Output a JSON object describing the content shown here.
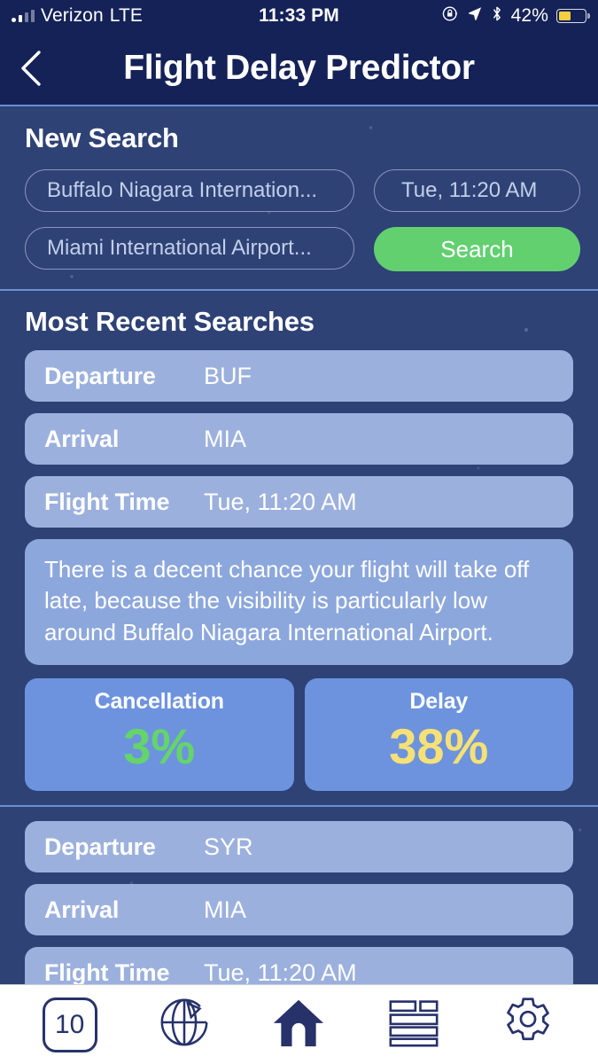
{
  "status_bar": {
    "carrier": "Verizon",
    "network": "LTE",
    "time": "11:33 PM",
    "battery_percent": "42%",
    "icons": [
      "signal-bars-icon",
      "rotation-lock-icon",
      "location-arrow-icon",
      "bluetooth-icon",
      "battery-icon"
    ],
    "battery_color": "#f3cf3f"
  },
  "navbar": {
    "back_icon": "chevron-left-icon",
    "title": "Flight Delay Predictor"
  },
  "new_search": {
    "title": "New Search",
    "departure_placeholder": "Buffalo Niagara Internation...",
    "departure_value": "",
    "arrival_placeholder": "Miami International Airport...",
    "arrival_value": "",
    "datetime_value": "Tue, 11:20 AM",
    "search_label": "Search",
    "search_color": "#63d070"
  },
  "recent": {
    "title": "Most Recent Searches",
    "entries": [
      {
        "rows": [
          {
            "label": "Departure",
            "value": "BUF"
          },
          {
            "label": "Arrival",
            "value": "MIA"
          },
          {
            "label": "Flight Time",
            "value": "Tue, 11:20 AM"
          }
        ],
        "note": "There is a decent chance your flight will take off late, because the visibility is particularly low around Buffalo Niagara International Airport.",
        "stats": [
          {
            "title": "Cancellation",
            "value": "3%",
            "color": "#64d46b"
          },
          {
            "title": "Delay",
            "value": "38%",
            "color": "#f5e175"
          }
        ]
      },
      {
        "rows": [
          {
            "label": "Departure",
            "value": "SYR"
          },
          {
            "label": "Arrival",
            "value": "MIA"
          },
          {
            "label": "Flight Time",
            "value": "Tue, 11:20 AM"
          }
        ]
      }
    ]
  },
  "toolbar": {
    "tab_count": "10",
    "items": [
      "tab-count-icon",
      "globe-icon",
      "home-icon",
      "layout-icon",
      "gear-icon"
    ],
    "icon_color": "#27326b"
  }
}
